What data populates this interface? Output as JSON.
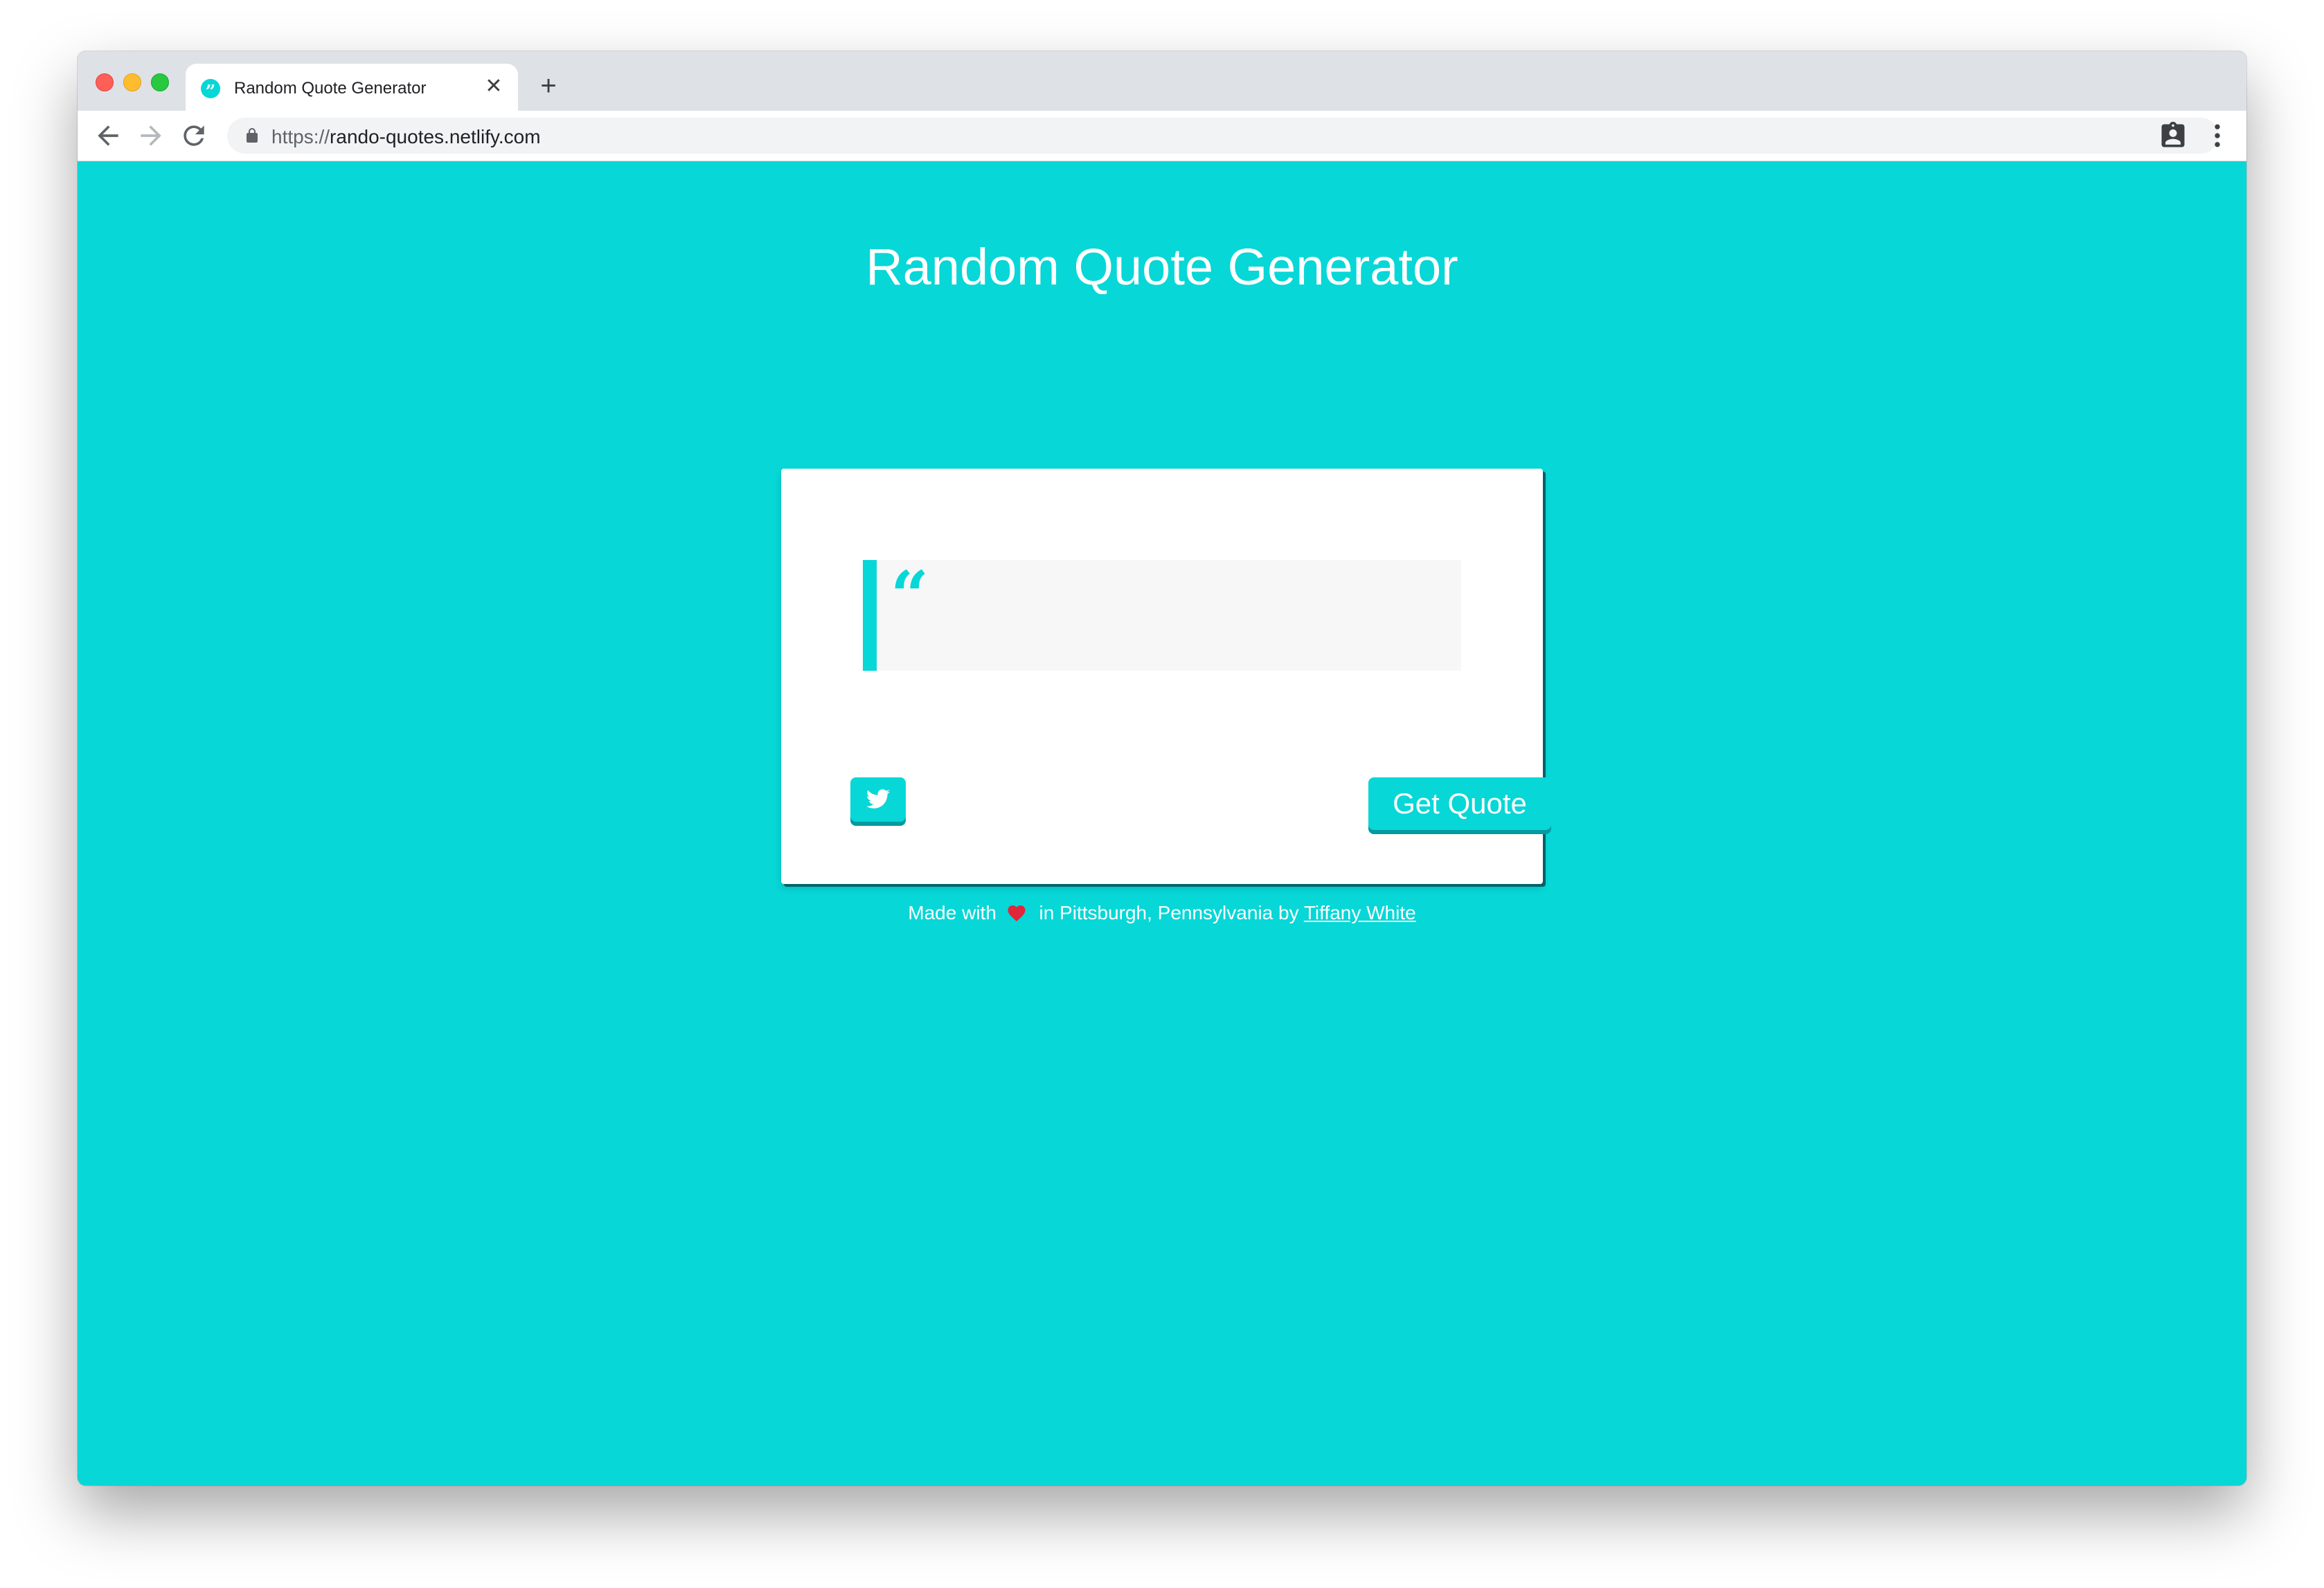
{
  "browser": {
    "tab": {
      "title": "Random Quote Generator",
      "favicon": "quote-favicon-icon",
      "close_symbol": "✕"
    },
    "new_tab_symbol": "+",
    "url": {
      "scheme": "https://",
      "host": "rando-quotes.netlify.com"
    },
    "icons": [
      "back-arrow-icon",
      "forward-arrow-icon",
      "reload-icon",
      "lock-icon",
      "extension-icon",
      "menu-icon"
    ]
  },
  "page": {
    "title": "Random Quote Generator",
    "quote_mark": "“",
    "quote_text": "",
    "tweet_icon": "twitter-icon",
    "get_quote_label": "Get Quote",
    "footer": {
      "prefix": "Made with",
      "suffix": "in Pittsburgh, Pennsylvania by",
      "author_link": "Tiffany White",
      "heart_icon": "heart-icon"
    }
  },
  "colors": {
    "accent": "#07d7d7",
    "button_shadow": "#049aa0",
    "card_shadow": "#04636a",
    "heart": "#e0263a"
  }
}
